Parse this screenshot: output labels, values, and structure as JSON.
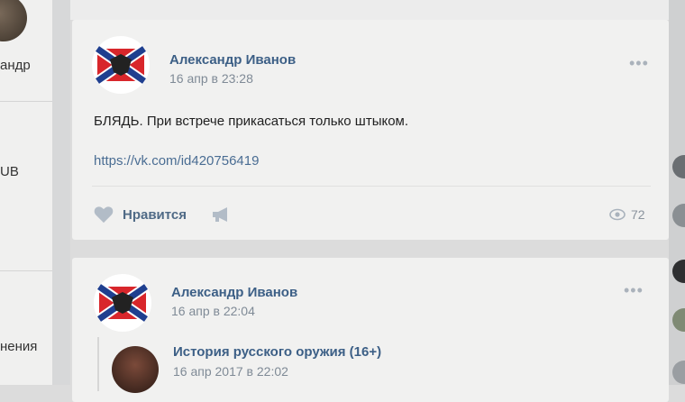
{
  "left_column": {
    "label_top": "андр",
    "label_mid": "UB",
    "label_bottom": "нения"
  },
  "posts": [
    {
      "author": "Александр Иванов",
      "date": "16 апр в 23:28",
      "more": "•••",
      "text": "БЛЯДЬ. При встрече прикасаться только штыком.",
      "link": "https://vk.com/id420756419",
      "like_label": "Нравится",
      "views": "72"
    },
    {
      "author": "Александр Иванов",
      "date": "16 апр в 22:04",
      "more": "•••",
      "repost": {
        "title": "История русского оружия (16+)",
        "date": "16 апр 2017 в 22:02"
      }
    }
  ],
  "icons": {
    "heart": "heart-icon",
    "share": "megaphone-icon",
    "views": "eye-icon",
    "more": "more-dots-icon"
  },
  "colors": {
    "link": "#4a6d93",
    "author": "#3c5f86",
    "flag_red": "#d8262b",
    "flag_blue": "#1f3f8f"
  }
}
